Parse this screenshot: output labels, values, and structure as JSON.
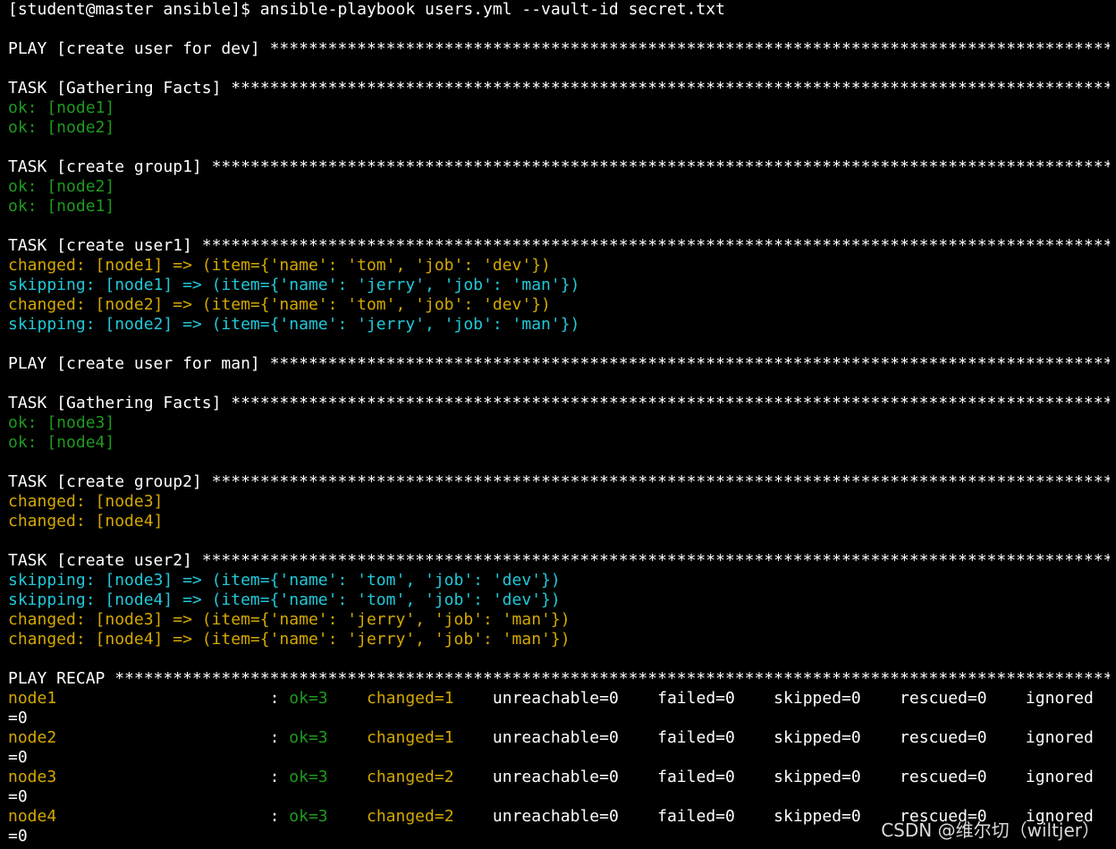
{
  "colors": {
    "background": "#000000",
    "text": "#ffffff",
    "ok": "#1e9a1e",
    "changed": "#d4a800",
    "skipping": "#20c8d8"
  },
  "terminal": {
    "lines": [
      {
        "text": "[student@master ansible]$ ansible-playbook users.yml --vault-id secret.txt",
        "color": "white"
      },
      {
        "text": "",
        "color": "white"
      },
      {
        "text": "PLAY [create user for dev] *****************************************************************************************************",
        "color": "white"
      },
      {
        "text": "",
        "color": "white"
      },
      {
        "text": "TASK [Gathering Facts] *********************************************************************************************************",
        "color": "white"
      },
      {
        "text": "ok: [node1]",
        "color": "green"
      },
      {
        "text": "ok: [node2]",
        "color": "green"
      },
      {
        "text": "",
        "color": "white"
      },
      {
        "text": "TASK [create group1] ***********************************************************************************************************",
        "color": "white"
      },
      {
        "text": "ok: [node2]",
        "color": "green"
      },
      {
        "text": "ok: [node1]",
        "color": "green"
      },
      {
        "text": "",
        "color": "white"
      },
      {
        "text": "TASK [create user1] ************************************************************************************************************",
        "color": "white"
      },
      {
        "text": "changed: [node1] => (item={'name': 'tom', 'job': 'dev'})",
        "color": "yellow"
      },
      {
        "text": "skipping: [node1] => (item={'name': 'jerry', 'job': 'man'})",
        "color": "cyan"
      },
      {
        "text": "changed: [node2] => (item={'name': 'tom', 'job': 'dev'})",
        "color": "yellow"
      },
      {
        "text": "skipping: [node2] => (item={'name': 'jerry', 'job': 'man'})",
        "color": "cyan"
      },
      {
        "text": "",
        "color": "white"
      },
      {
        "text": "PLAY [create user for man] *****************************************************************************************************",
        "color": "white"
      },
      {
        "text": "",
        "color": "white"
      },
      {
        "text": "TASK [Gathering Facts] *********************************************************************************************************",
        "color": "white"
      },
      {
        "text": "ok: [node3]",
        "color": "green"
      },
      {
        "text": "ok: [node4]",
        "color": "green"
      },
      {
        "text": "",
        "color": "white"
      },
      {
        "text": "TASK [create group2] ***********************************************************************************************************",
        "color": "white"
      },
      {
        "text": "changed: [node3]",
        "color": "yellow"
      },
      {
        "text": "changed: [node4]",
        "color": "yellow"
      },
      {
        "text": "",
        "color": "white"
      },
      {
        "text": "TASK [create user2] ************************************************************************************************************",
        "color": "white"
      },
      {
        "text": "skipping: [node3] => (item={'name': 'tom', 'job': 'dev'})",
        "color": "cyan"
      },
      {
        "text": "skipping: [node4] => (item={'name': 'tom', 'job': 'dev'})",
        "color": "cyan"
      },
      {
        "text": "changed: [node3] => (item={'name': 'jerry', 'job': 'man'})",
        "color": "yellow"
      },
      {
        "text": "changed: [node4] => (item={'name': 'jerry', 'job': 'man'})",
        "color": "yellow"
      },
      {
        "text": "",
        "color": "white"
      },
      {
        "text": "PLAY RECAP *********************************************************************************************************************",
        "color": "white"
      }
    ],
    "recap": [
      {
        "host": "node1",
        "ok": "ok=3",
        "changed": "changed=1",
        "rest": "unreachable=0    failed=0    skipped=0    rescued=0    ignored",
        "wrap": "=0"
      },
      {
        "host": "node2",
        "ok": "ok=3",
        "changed": "changed=1",
        "rest": "unreachable=0    failed=0    skipped=0    rescued=0    ignored",
        "wrap": "=0"
      },
      {
        "host": "node3",
        "ok": "ok=3",
        "changed": "changed=2",
        "rest": "unreachable=0    failed=0    skipped=0    rescued=0    ignored",
        "wrap": "=0"
      },
      {
        "host": "node4",
        "ok": "ok=3",
        "changed": "changed=2",
        "rest": "unreachable=0    failed=0    skipped=0    rescued=0    ignored",
        "wrap": "=0"
      }
    ]
  },
  "watermark": "CSDN @维尔切（wiltjer）"
}
